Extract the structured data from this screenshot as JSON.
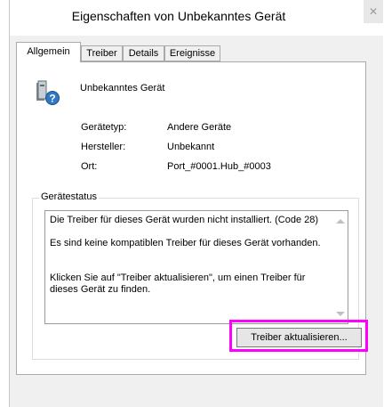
{
  "window": {
    "title": "Eigenschaften von Unbekanntes Gerät",
    "close_glyph": "✕"
  },
  "tabs": [
    {
      "label": "Allgemein",
      "active": true
    },
    {
      "label": "Treiber",
      "active": false
    },
    {
      "label": "Details",
      "active": false
    },
    {
      "label": "Ereignisse",
      "active": false
    }
  ],
  "device": {
    "name": "Unbekanntes Gerät",
    "icon": "unknown-device-icon"
  },
  "properties": [
    {
      "label": "Gerätetyp:",
      "value": "Andere Geräte"
    },
    {
      "label": "Hersteller:",
      "value": "Unbekannt"
    },
    {
      "label": "Ort:",
      "value": "Port_#0001.Hub_#0003"
    }
  ],
  "status": {
    "group_label": "Gerätestatus",
    "lines": [
      "Die Treiber für dieses Gerät wurden nicht installiert. (Code 28)",
      "Es sind keine kompatiblen Treiber für dieses Gerät vorhanden.",
      "Klicken Sie auf \"Treiber aktualisieren\", um einen Treiber für dieses Gerät zu finden."
    ]
  },
  "buttons": {
    "update_driver": "Treiber aktualisieren..."
  },
  "colors": {
    "highlight": "#ff00ff"
  }
}
